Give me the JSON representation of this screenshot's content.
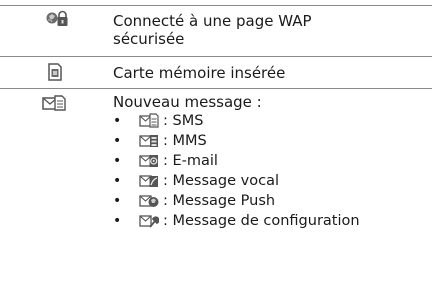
{
  "rows": [
    {
      "icon": "wap-secure-icon",
      "lines": [
        "Connecté à une page WAP",
        "sécurisée"
      ]
    },
    {
      "icon": "memory-card-icon",
      "lines": [
        "Carte mémoire insérée"
      ]
    },
    {
      "icon": "new-message-icon",
      "lines": [
        "Nouveau message :"
      ]
    }
  ],
  "message_types": [
    {
      "icon": "sms-icon",
      "label": ": SMS"
    },
    {
      "icon": "mms-icon",
      "label": ": MMS"
    },
    {
      "icon": "email-icon",
      "label": ": E-mail"
    },
    {
      "icon": "voicemail-icon",
      "label": ": Message vocal"
    },
    {
      "icon": "push-icon",
      "label": ": Message Push"
    },
    {
      "icon": "config-icon",
      "label": ": Message de configuration"
    }
  ],
  "bullet": "•",
  "colors": {
    "rule": "#8a8a8a",
    "icon": "#555555",
    "text": "#1a1a1a"
  }
}
